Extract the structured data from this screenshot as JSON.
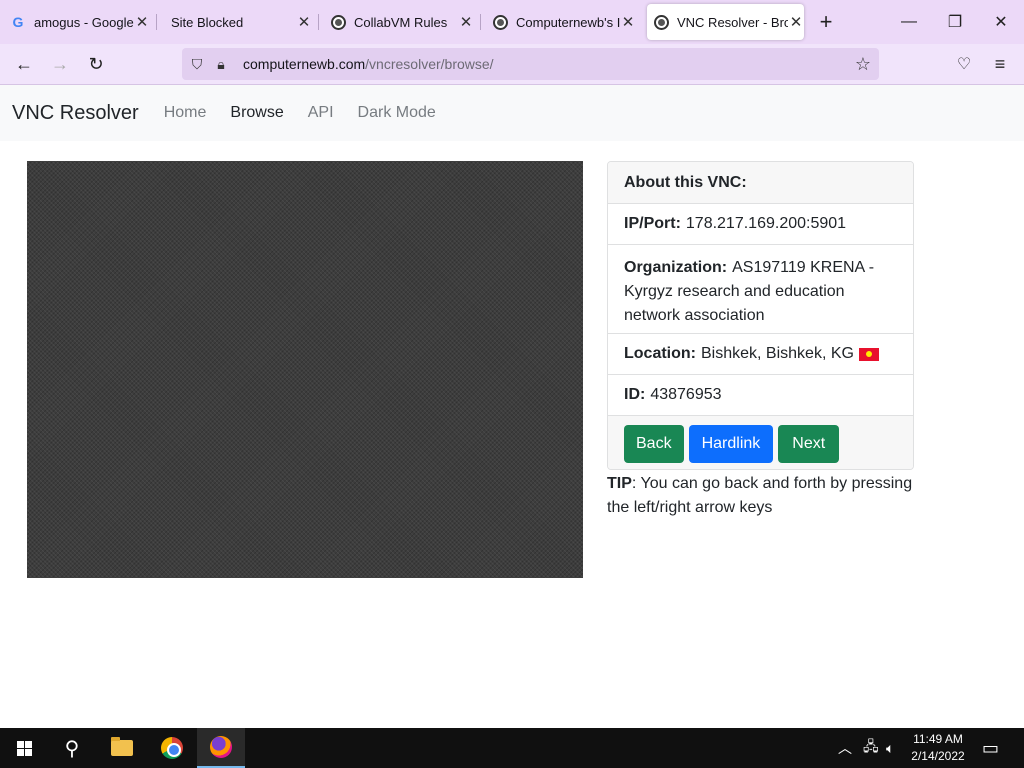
{
  "tabs": [
    {
      "title": "amogus - Google Sea",
      "icon": "google-icon"
    },
    {
      "title": "Site Blocked",
      "icon": "none"
    },
    {
      "title": "CollabVM Rules",
      "icon": "collabvm-icon"
    },
    {
      "title": "Computernewb's Inte",
      "icon": "collabvm-icon"
    },
    {
      "title": "VNC Resolver - Brow",
      "icon": "collabvm-icon",
      "active": true
    }
  ],
  "url": {
    "domain": "computernewb.com",
    "path": "/vncresolver/browse/"
  },
  "site": {
    "brand": "VNC Resolver",
    "nav": [
      "Home",
      "Browse",
      "API",
      "Dark Mode"
    ],
    "active_nav": "Browse"
  },
  "card": {
    "header": "About this VNC:",
    "ip_label": "IP/Port:",
    "ip_value": "178.217.169.200:5901",
    "org_label": "Organization:",
    "org_value": "AS197119 KRENA - Kyrgyz research and education network association",
    "loc_label": "Location:",
    "loc_value": "Bishkek, Bishkek, KG",
    "id_label": "ID:",
    "id_value": "43876953",
    "buttons": {
      "back": "Back",
      "hardlink": "Hardlink",
      "next": "Next"
    }
  },
  "tip": {
    "label": "TIP",
    "text": ": You can go back and forth by pressing the left/right arrow keys"
  },
  "clock": {
    "time": "11:49 AM",
    "date": "2/14/2022"
  },
  "colors": {
    "tab_strip": "#ecd9f8",
    "toolbar": "#f1e4fb",
    "btn_green": "#198754",
    "btn_blue": "#0d6efd",
    "flag_red": "#e8112d"
  }
}
